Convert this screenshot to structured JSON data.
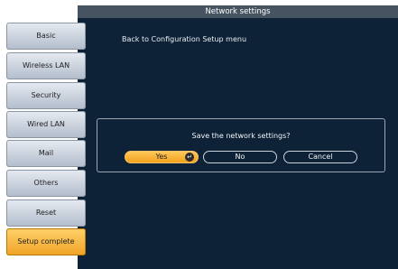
{
  "window": {
    "title": "Network settings"
  },
  "sidebar": {
    "items": [
      {
        "label": "Basic"
      },
      {
        "label": "Wireless LAN"
      },
      {
        "label": "Security"
      },
      {
        "label": "Wired LAN"
      },
      {
        "label": "Mail"
      },
      {
        "label": "Others"
      },
      {
        "label": "Reset"
      },
      {
        "label": "Setup complete"
      }
    ],
    "selected": "Setup complete"
  },
  "main": {
    "back_label": "Back to Configuration Setup menu"
  },
  "dialog": {
    "message": "Save the network settings?",
    "buttons": {
      "yes": "Yes",
      "no": "No",
      "cancel": "Cancel"
    },
    "enter_icon": "enter-key-icon",
    "focused_button": "Yes"
  },
  "colors": {
    "panel_background": "#0d2236",
    "title_bar": "#465461",
    "accent_orange": "#f3a11e",
    "sidebar_button": "#cdd5df"
  }
}
